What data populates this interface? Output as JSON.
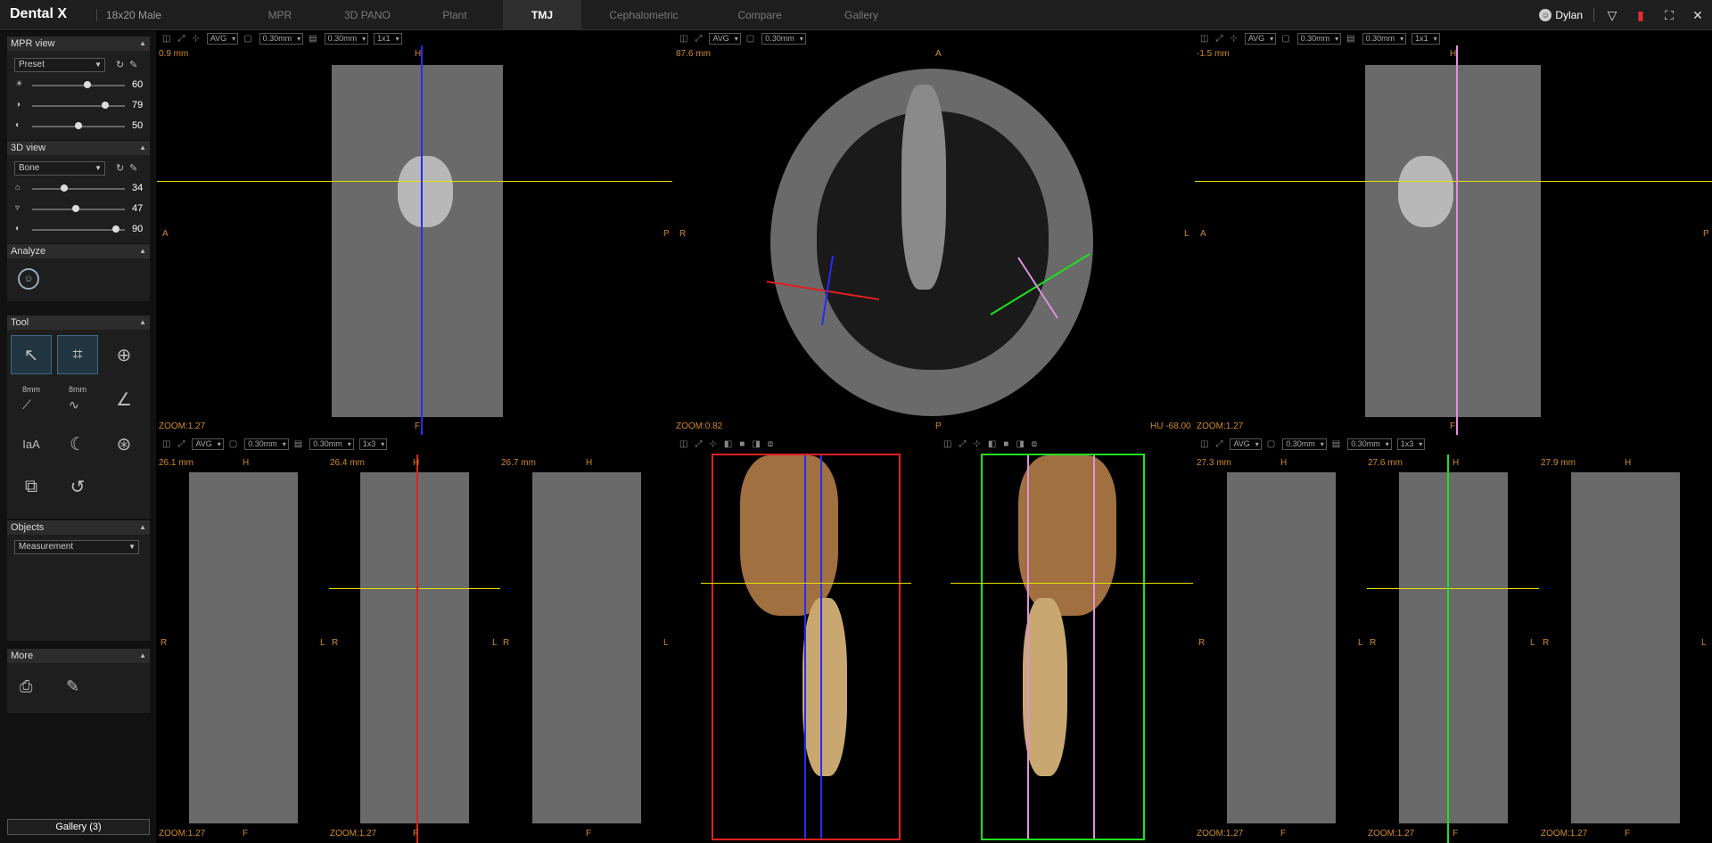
{
  "app": {
    "logo": "Dental X",
    "patient": "18x20 Male",
    "user": "Dylan"
  },
  "tabs": [
    {
      "label": "MPR"
    },
    {
      "label": "3D PANO"
    },
    {
      "label": "Plant"
    },
    {
      "label": "TMJ",
      "active": true
    },
    {
      "label": "Cephalometric"
    },
    {
      "label": "Compare"
    },
    {
      "label": "Gallery"
    }
  ],
  "sidebar": {
    "mpr": {
      "title": "MPR view",
      "preset": "Preset",
      "sliders": [
        {
          "icon": "brightness-icon",
          "value": "60",
          "fraction": 0.6
        },
        {
          "icon": "contrast-icon",
          "value": "79",
          "fraction": 0.79
        },
        {
          "icon": "gamma-icon",
          "value": "50",
          "fraction": 0.5
        }
      ]
    },
    "view3d": {
      "title": "3D view",
      "preset": "Bone",
      "sliders": [
        {
          "icon": "opacity-icon",
          "value": "34",
          "fraction": 0.34
        },
        {
          "icon": "threshold-icon",
          "value": "47",
          "fraction": 0.47
        },
        {
          "icon": "light-icon",
          "value": "90",
          "fraction": 0.9
        }
      ]
    },
    "analyze": {
      "title": "Analyze"
    },
    "tool": {
      "title": "Tool",
      "length_label": "8mm",
      "curve_label": "8mm",
      "text_label": "aA"
    },
    "objects": {
      "title": "Objects",
      "select": "Measurement"
    },
    "more": {
      "title": "More"
    },
    "gallery_button": "Gallery (3)"
  },
  "viewports": {
    "top_left": {
      "avg": "AVG",
      "thickness1": "0.30mm",
      "thickness2": "0.30mm",
      "layout": "1x1",
      "depth": "0.9 mm",
      "top": "H",
      "bottom": "F",
      "left": "A",
      "right": "P",
      "zoom": "ZOOM:1.27"
    },
    "top_center": {
      "avg": "AVG",
      "thickness": "0.30mm",
      "depth": "87.6 mm",
      "top": "A",
      "bottom": "P",
      "left": "R",
      "right": "L",
      "zoom": "ZOOM:0.82",
      "hu": "HU -68.00"
    },
    "top_right": {
      "avg": "AVG",
      "thickness1": "0.30mm",
      "thickness2": "0.30mm",
      "layout": "1x1",
      "depth": "-1.5 mm",
      "top": "H",
      "bottom": "F",
      "left": "A",
      "right": "P",
      "zoom": "ZOOM:1.27"
    },
    "bottom_left": {
      "avg": "AVG",
      "thickness1": "0.30mm",
      "thickness2": "0.30mm",
      "layout": "1x3",
      "slices": [
        {
          "depth": "26.1 mm",
          "top": "H",
          "bottom": "F",
          "left": "R",
          "right": "L",
          "zoom": "ZOOM:1.27"
        },
        {
          "depth": "26.4 mm",
          "top": "H",
          "bottom": "F",
          "left": "R",
          "right": "L",
          "zoom": "ZOOM:1.27"
        },
        {
          "depth": "26.7 mm",
          "top": "H",
          "bottom": "F",
          "left": "R",
          "right": "L",
          "zoom": ""
        }
      ]
    },
    "bottom_right": {
      "avg": "AVG",
      "thickness1": "0.30mm",
      "thickness2": "0.30mm",
      "layout": "1x3",
      "slices": [
        {
          "depth": "27.3 mm",
          "top": "H",
          "bottom": "F",
          "left": "R",
          "right": "L",
          "zoom": "ZOOM:1.27"
        },
        {
          "depth": "27.6 mm",
          "top": "H",
          "bottom": "F",
          "left": "R",
          "right": "L",
          "zoom": "ZOOM:1.27"
        },
        {
          "depth": "27.9 mm",
          "top": "H",
          "bottom": "F",
          "left": "R",
          "right": "L",
          "zoom": "ZOOM:1.27"
        }
      ]
    }
  },
  "colors": {
    "accent": "#3a6a86",
    "axis_yellow": "#e8e000",
    "blue": "#2a2aff",
    "red": "#e02020",
    "green": "#20e020",
    "pink": "#e090e0",
    "orange": "#d08a2a"
  }
}
